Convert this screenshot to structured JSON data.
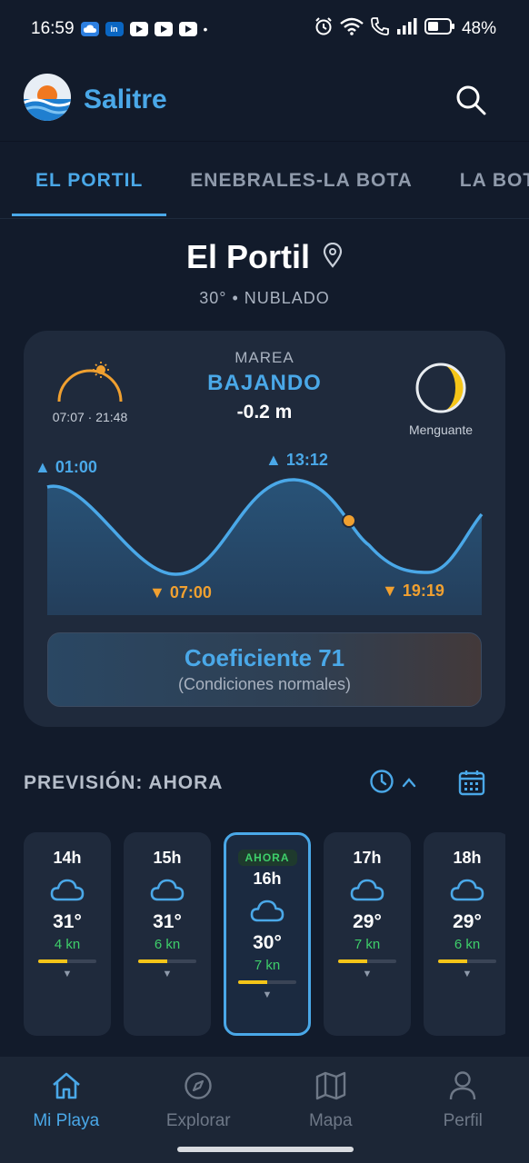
{
  "status_bar": {
    "time": "16:59",
    "dot": "•",
    "battery": "48%",
    "icons": [
      "cloud-icon",
      "linkedin-icon",
      "youtube-icon",
      "youtube-icon",
      "youtube-icon",
      "alarm-icon",
      "wifi-icon",
      "call-icon",
      "signal-icon",
      "battery-icon"
    ]
  },
  "app": {
    "title": "Salitre",
    "logo": "sun-over-sea-logo"
  },
  "tabs": [
    {
      "label": "EL PORTIL",
      "active": true
    },
    {
      "label": "ENEBRALES-LA BOTA",
      "active": false
    },
    {
      "label": "LA BOT",
      "active": false
    }
  ],
  "location": {
    "name": "El Portil",
    "summary": "30° • NUBLADO"
  },
  "tide": {
    "sun_times": "07:07 · 21:48",
    "label": "MAREA",
    "state": "BAJANDO",
    "height": "-0.2 m",
    "moon_phase": "Menguante",
    "high_1": "▲ 01:00",
    "high_2": "▲ 13:12",
    "low_1": "▼ 07:00",
    "low_2": "▼ 19:19",
    "coefficient": "Coeficiente 71",
    "coefficient_desc": "(Condiciones normales)"
  },
  "forecast": {
    "title": "PREVISIÓN: AHORA",
    "now_badge": "AHORA",
    "hours": [
      {
        "time": "14h",
        "temp": "31°",
        "wind": "4 kn",
        "wind_level": 0.5,
        "icon": "cloud-icon"
      },
      {
        "time": "15h",
        "temp": "31°",
        "wind": "6 kn",
        "wind_level": 0.5,
        "icon": "cloud-icon"
      },
      {
        "time": "16h",
        "temp": "30°",
        "wind": "7 kn",
        "wind_level": 0.5,
        "icon": "cloud-icon"
      },
      {
        "time": "17h",
        "temp": "29°",
        "wind": "7 kn",
        "wind_level": 0.5,
        "icon": "cloud-icon"
      },
      {
        "time": "18h",
        "temp": "29°",
        "wind": "6 kn",
        "wind_level": 0.5,
        "icon": "cloud-icon"
      }
    ]
  },
  "nav": [
    {
      "label": "Mi Playa",
      "icon": "home-icon",
      "active": true
    },
    {
      "label": "Explorar",
      "icon": "compass-icon",
      "active": false
    },
    {
      "label": "Mapa",
      "icon": "map-icon",
      "active": false
    },
    {
      "label": "Perfil",
      "icon": "user-icon",
      "active": false
    }
  ],
  "colors": {
    "accent": "#4aa8e8",
    "orange": "#f0a030",
    "green": "#3ecf6a",
    "background": "#121b2b",
    "card": "#1f2a3c"
  }
}
